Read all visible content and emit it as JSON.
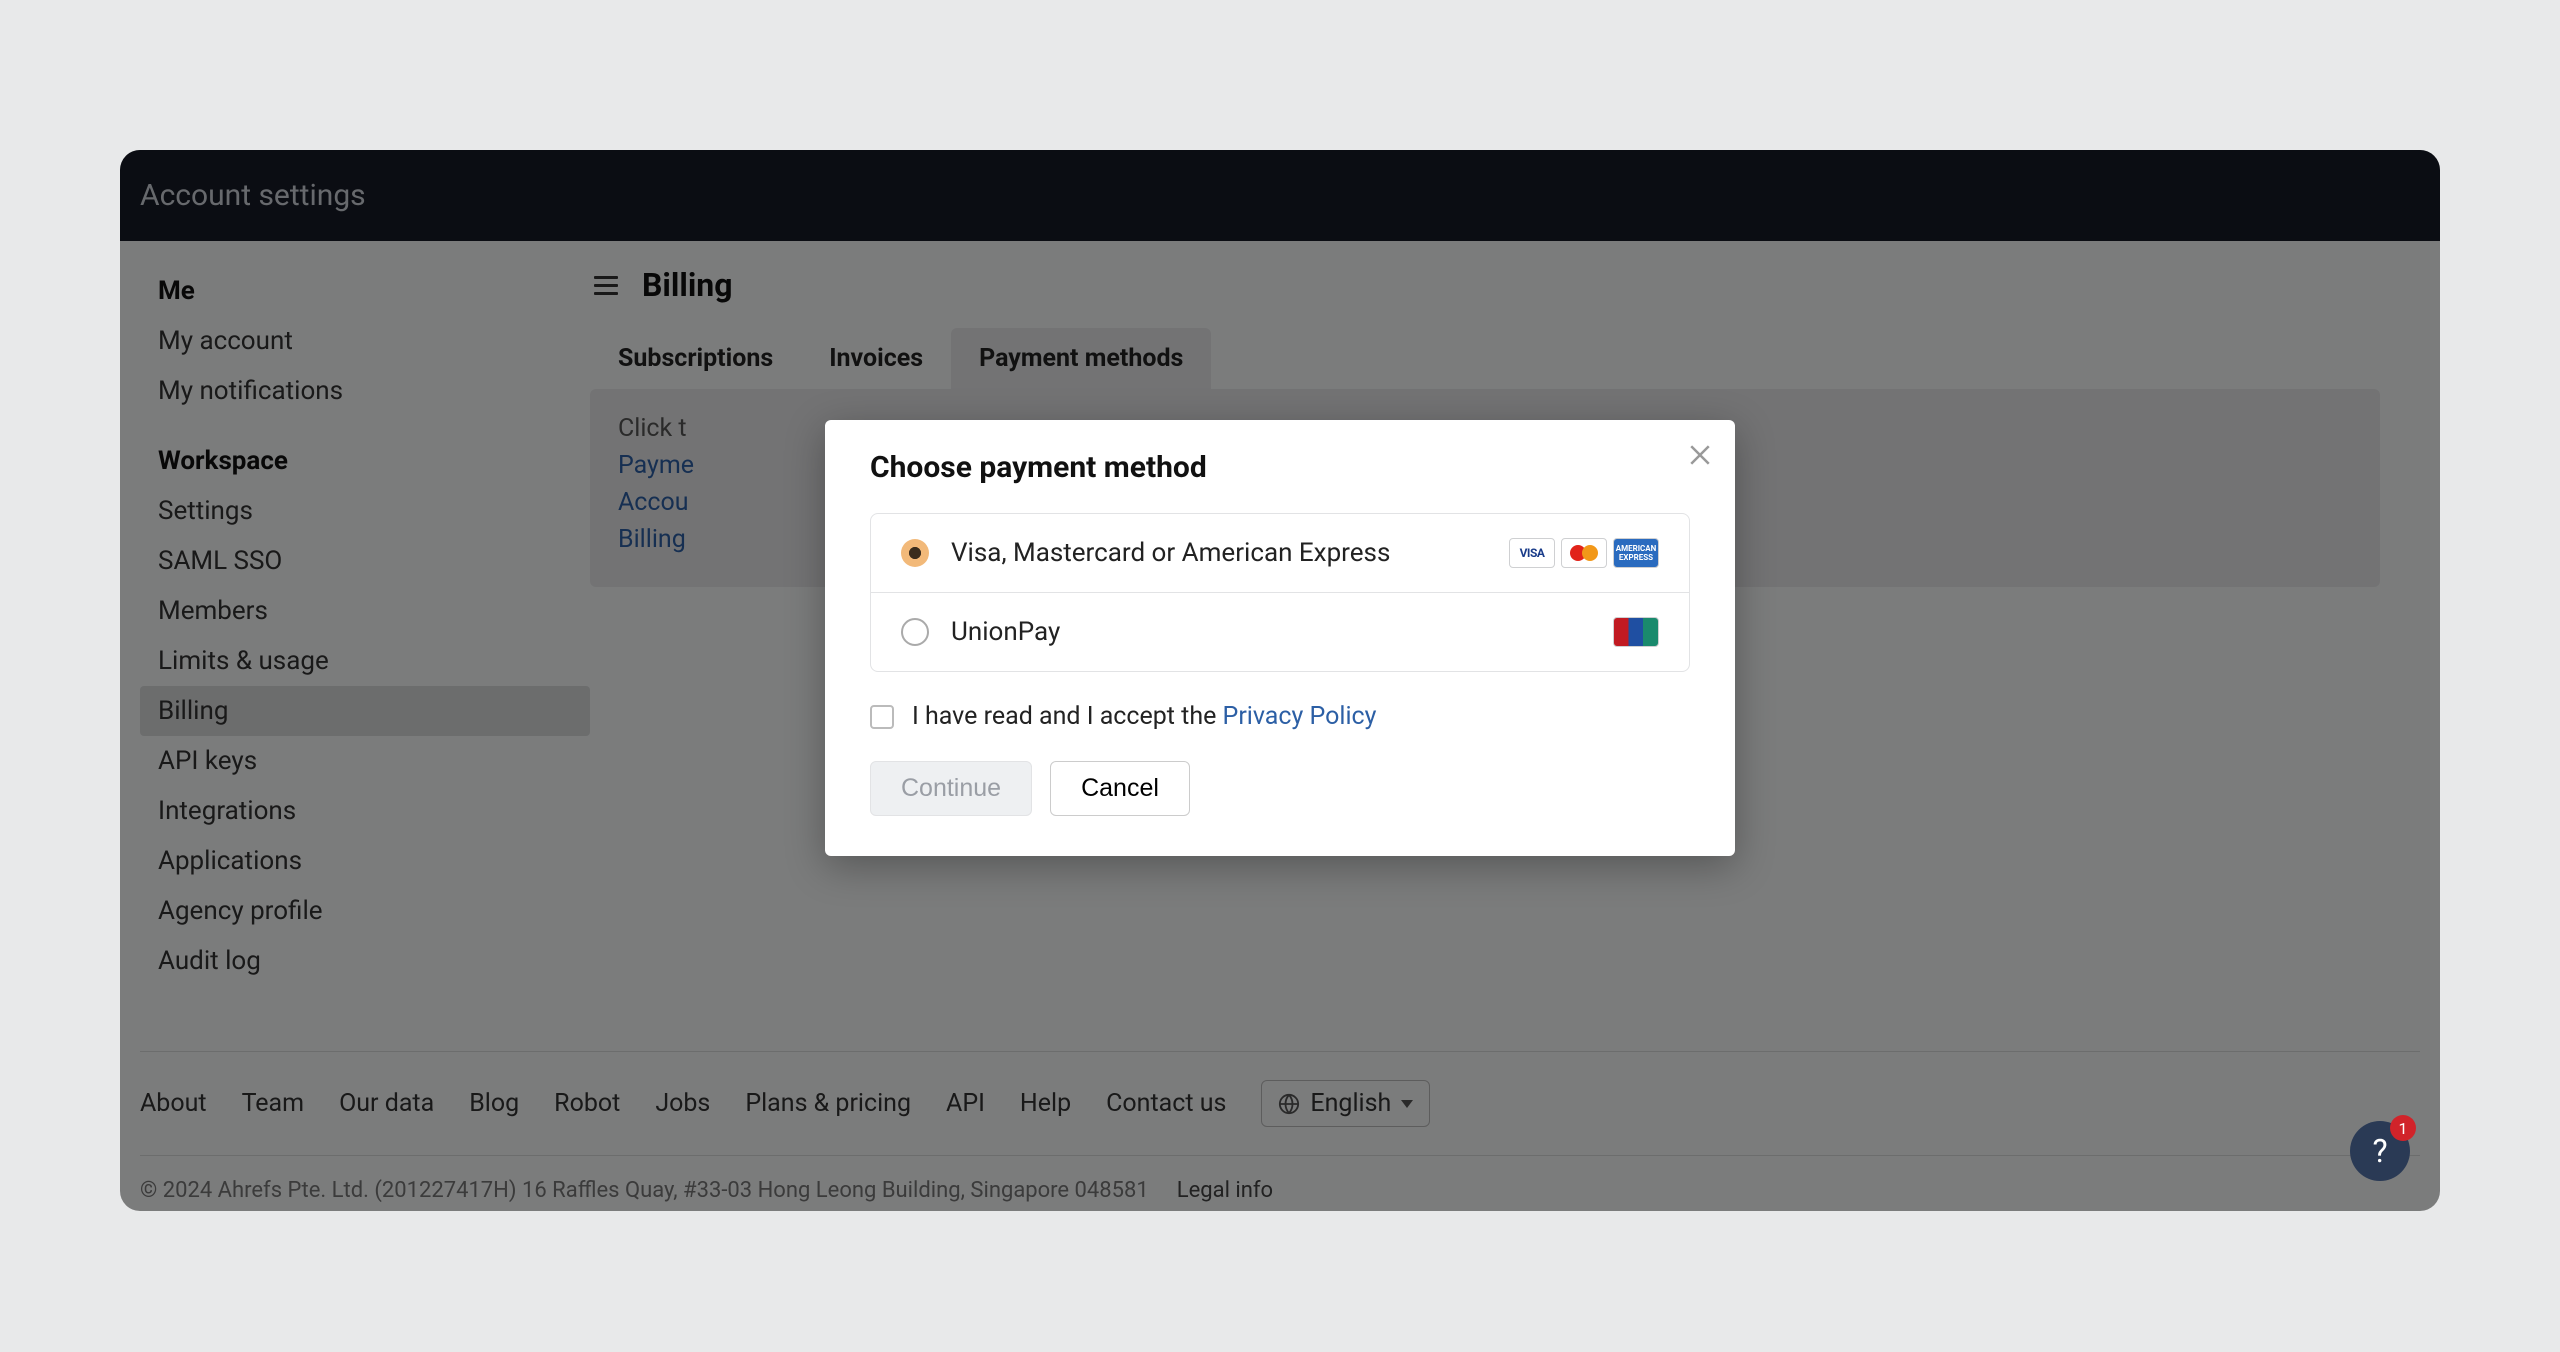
{
  "header": {
    "title": "Account settings"
  },
  "sidebar": {
    "groups": [
      {
        "title": "Me",
        "items": [
          {
            "label": "My account",
            "active": false
          },
          {
            "label": "My notifications",
            "active": false
          }
        ]
      },
      {
        "title": "Workspace",
        "items": [
          {
            "label": "Settings",
            "active": false
          },
          {
            "label": "SAML SSO",
            "active": false
          },
          {
            "label": "Members",
            "active": false
          },
          {
            "label": "Limits & usage",
            "active": false
          },
          {
            "label": "Billing",
            "active": true
          },
          {
            "label": "API keys",
            "active": false
          },
          {
            "label": "Integrations",
            "active": false
          },
          {
            "label": "Applications",
            "active": false
          },
          {
            "label": "Agency profile",
            "active": false
          },
          {
            "label": "Audit log",
            "active": false
          }
        ]
      }
    ]
  },
  "main": {
    "page_title": "Billing",
    "tabs": [
      {
        "label": "Subscriptions",
        "active": false
      },
      {
        "label": "Invoices",
        "active": false
      },
      {
        "label": "Payment methods",
        "active": true
      }
    ],
    "panel": {
      "lead": "Click t",
      "links": [
        "Payme",
        "Accou",
        "Billing"
      ]
    }
  },
  "modal": {
    "title": "Choose payment method",
    "options": [
      {
        "label": "Visa, Mastercard or American Express",
        "selected": true,
        "icons": [
          "visa",
          "mc",
          "amex"
        ]
      },
      {
        "label": "UnionPay",
        "selected": false,
        "icons": [
          "unionpay"
        ]
      }
    ],
    "consent_prefix": "I have read and I accept the ",
    "consent_link": "Privacy Policy",
    "continue": "Continue",
    "cancel": "Cancel"
  },
  "footer": {
    "links": [
      "About",
      "Team",
      "Our data",
      "Blog",
      "Robot",
      "Jobs",
      "Plans & pricing",
      "API",
      "Help",
      "Contact us"
    ],
    "language": "English",
    "copyright": "© 2024 Ahrefs Pte. Ltd. (201227417H) 16 Raffles Quay, #33-03 Hong Leong Building, Singapore 048581",
    "legal": "Legal info"
  },
  "help": {
    "badge": "1",
    "label": "?"
  }
}
